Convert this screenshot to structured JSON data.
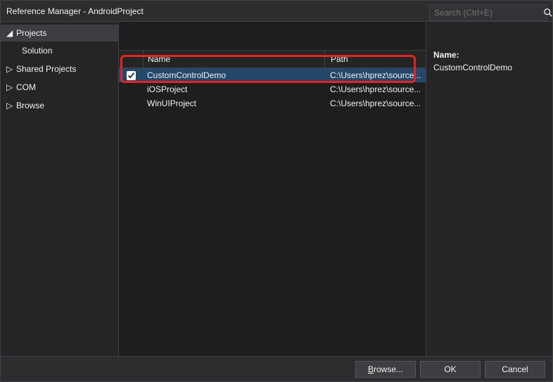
{
  "window": {
    "title": "Reference Manager - AndroidProject",
    "help": "?",
    "close": "×"
  },
  "sidebar": {
    "projects": {
      "label": "Projects",
      "subitems": [
        {
          "label": "Solution"
        }
      ]
    },
    "items": [
      {
        "label": "Shared Projects"
      },
      {
        "label": "COM"
      },
      {
        "label": "Browse"
      }
    ]
  },
  "search": {
    "placeholder": "Search (Ctrl+E)"
  },
  "columns": {
    "name": "Name",
    "path": "Path"
  },
  "rows": [
    {
      "checked": true,
      "name": "CustomControlDemo",
      "path": "C:\\Users\\hprez\\source...",
      "selected": true
    },
    {
      "checked": false,
      "name": "iOSProject",
      "path": "C:\\Users\\hprez\\source...",
      "selected": false
    },
    {
      "checked": false,
      "name": "WinUIProject",
      "path": "C:\\Users\\hprez\\source...",
      "selected": false
    }
  ],
  "details": {
    "label": "Name:",
    "value": "CustomControlDemo"
  },
  "footer": {
    "browse": "Browse...",
    "ok": "OK",
    "cancel": "Cancel"
  }
}
